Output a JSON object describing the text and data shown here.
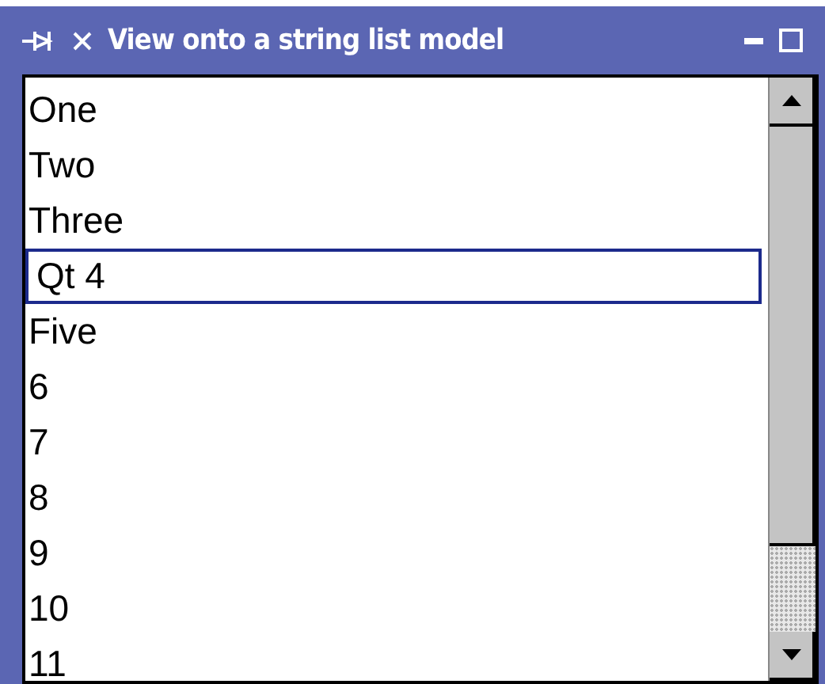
{
  "window": {
    "title": "View onto a string list model"
  },
  "list": {
    "items": [
      {
        "text": "One",
        "editing": false
      },
      {
        "text": "Two",
        "editing": false
      },
      {
        "text": "Three",
        "editing": false
      },
      {
        "text": "Qt 4",
        "editing": true
      },
      {
        "text": "Five",
        "editing": false
      },
      {
        "text": "6",
        "editing": false
      },
      {
        "text": "7",
        "editing": false
      },
      {
        "text": "8",
        "editing": false
      },
      {
        "text": "9",
        "editing": false
      },
      {
        "text": "10",
        "editing": false
      },
      {
        "text": "11",
        "editing": false
      }
    ]
  }
}
